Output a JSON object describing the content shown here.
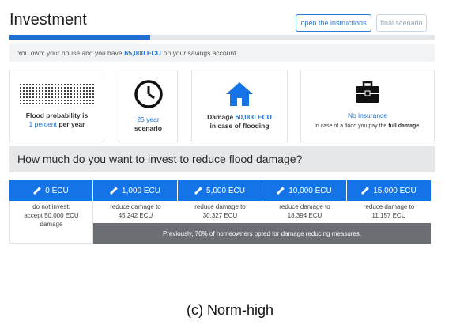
{
  "header": {
    "title": "Investment",
    "instructions_button": "open the instructions",
    "final_button": "final scenario"
  },
  "progress": {
    "fraction": 0.33
  },
  "info": {
    "prefix": "You own: your house and you have",
    "amount": "65,000 ECU",
    "suffix": "on your savings account"
  },
  "cards": {
    "flood": {
      "line1": "Flood probability is",
      "line2_blue": "1 percent",
      "line2_rest": "per year"
    },
    "scenario": {
      "line1": "25 year",
      "line2": "scenario"
    },
    "damage": {
      "line1_prefix": "Damage",
      "line1_blue": "50,000 ECU",
      "line2": "in case of flooding"
    },
    "insurance": {
      "title": "No insurance",
      "desc_prefix": "In case of a flood you pay the",
      "desc_bold": "full damage."
    }
  },
  "question": "How much do you want to invest to reduce flood damage?",
  "options": [
    {
      "label": "0 ECU",
      "desc1": "do not invest:",
      "desc2": "accept 50,000 ECU",
      "desc3": "damage"
    },
    {
      "label": "1,000 ECU",
      "desc1": "reduce damage to",
      "desc2": "45,242 ECU"
    },
    {
      "label": "5,000 ECU",
      "desc1": "reduce damage to",
      "desc2": "30,327 ECU"
    },
    {
      "label": "10,000 ECU",
      "desc1": "reduce damage to",
      "desc2": "18,394 ECU"
    },
    {
      "label": "15,000 ECU",
      "desc1": "reduce damage to",
      "desc2": "11,157 ECU"
    }
  ],
  "norm_message": "Previously, 70% of homeowners opted for damage reducing measures.",
  "caption": "(c) Norm-high",
  "icons": {
    "wrench": "wrench-icon",
    "clock": "clock-icon",
    "house": "house-icon",
    "toolbox": "toolbox-icon"
  },
  "colors": {
    "accent": "#1473e6",
    "norm_bar": "#6b6f74"
  }
}
